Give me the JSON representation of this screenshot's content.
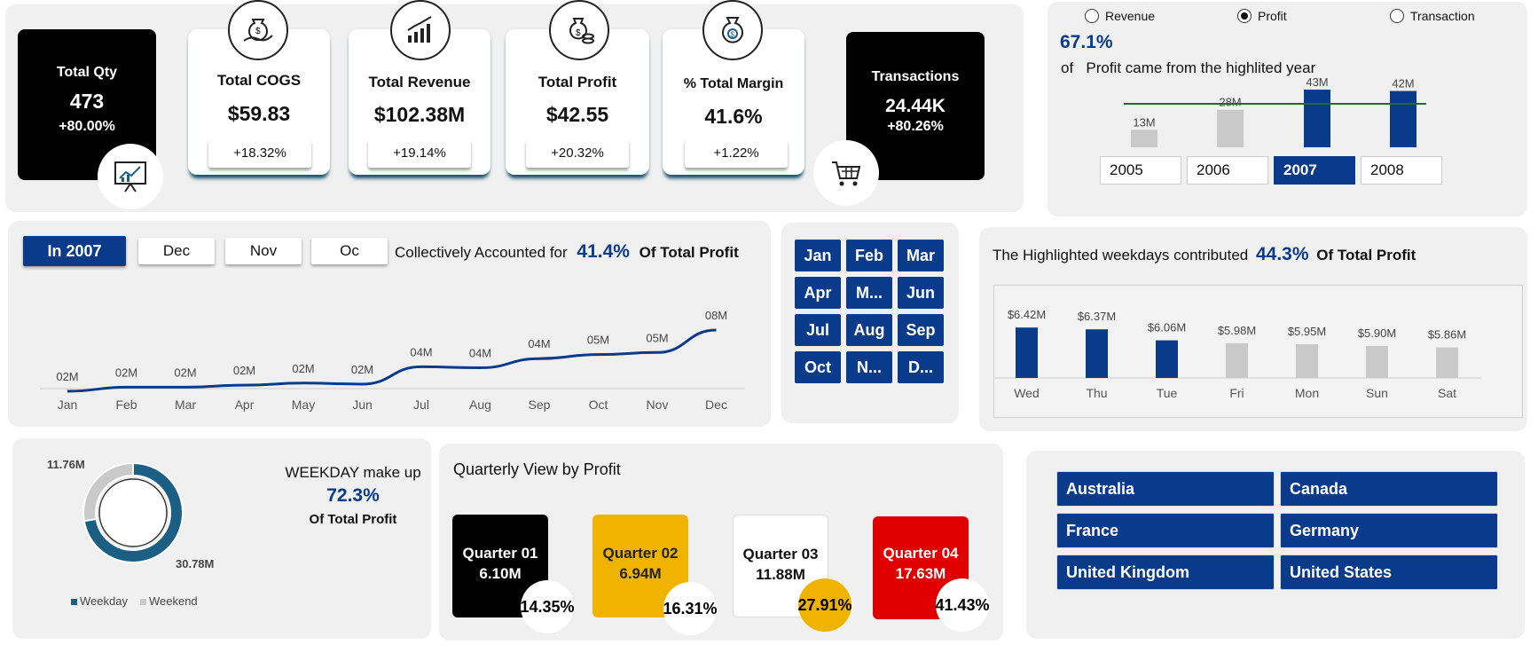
{
  "kpis": {
    "total_qty": {
      "title": "Total Qty",
      "value": "473",
      "change": "+80.00%"
    },
    "total_cogs": {
      "title": "Total COGS",
      "value": "$59.83",
      "change": "+18.32%"
    },
    "total_revenue": {
      "title": "Total Revenue",
      "value": "$102.38M",
      "change": "+19.14%"
    },
    "total_profit": {
      "title": "Total Profit",
      "value": "$42.55",
      "change": "+20.32%"
    },
    "total_margin": {
      "title": "% Total Margin",
      "value": "41.6%",
      "change": "+1.22%"
    },
    "transactions": {
      "title": "Transactions",
      "value": "24.44K",
      "change": "+80.26%"
    }
  },
  "year_panel": {
    "radios": [
      {
        "label": "Revenue",
        "selected": false
      },
      {
        "label": "Profit",
        "selected": true
      },
      {
        "label": "Transaction",
        "selected": false
      }
    ],
    "pct": "67.1%",
    "sentence_prefix": "of",
    "sentence": "Profit came from the highlited year",
    "years": [
      "2005",
      "2006",
      "2007",
      "2008"
    ],
    "selected_year": "2007"
  },
  "month_panel": {
    "tabs": [
      "In 2007",
      "Dec",
      "Nov",
      "Oc"
    ],
    "text_prefix": "Collectively Accounted for",
    "pct": "41.4%",
    "text_suffix": "Of Total Profit"
  },
  "month_slicer": [
    "Jan",
    "Feb",
    "Mar",
    "Apr",
    "M...",
    "Jun",
    "Jul",
    "Aug",
    "Sep",
    "Oct",
    "N...",
    "D..."
  ],
  "weekday_panel": {
    "text_prefix": "The Highlighted weekdays contributed",
    "pct": "44.3%",
    "text_suffix": "Of Total Profit"
  },
  "donut_panel": {
    "title": "WEEKDAY make up",
    "pct": "72.3%",
    "subtitle": "Of Total Profit",
    "weekend_label": "11.76M",
    "weekday_label": "30.78M",
    "legend": [
      "Weekday",
      "Weekend"
    ]
  },
  "quarter_panel": {
    "title": "Quarterly View by Profit",
    "quarters": [
      {
        "name": "Quarter 01",
        "value": "6.10M",
        "pct": "14.35%"
      },
      {
        "name": "Quarter 02",
        "value": "6.94M",
        "pct": "16.31%"
      },
      {
        "name": "Quarter 03",
        "value": "11.88M",
        "pct": "27.91%"
      },
      {
        "name": "Quarter 04",
        "value": "17.63M",
        "pct": "41.43%"
      }
    ]
  },
  "countries": [
    "Australia",
    "Canada",
    "France",
    "Germany",
    "United Kingdom",
    "United States"
  ],
  "colors": {
    "navy": "#0a3a8a",
    "teal": "#1b5f85",
    "grey": "#c9c9c9",
    "gold": "#f0b400",
    "red": "#e00000"
  },
  "chart_data": [
    {
      "type": "bar",
      "categories": [
        "2005",
        "2006",
        "2007",
        "2008"
      ],
      "values": [
        13,
        28,
        43,
        42
      ],
      "labels": [
        "13M",
        "28M",
        "43M",
        "42M"
      ],
      "highlighted": [
        "2007",
        "2008"
      ]
    },
    {
      "type": "line",
      "categories": [
        "Jan",
        "Feb",
        "Mar",
        "Apr",
        "May",
        "Jun",
        "Jul",
        "Aug",
        "Sep",
        "Oct",
        "Nov",
        "Dec"
      ],
      "values": [
        2,
        2.4,
        2.4,
        2.6,
        2.8,
        2.7,
        4.4,
        4.3,
        5.2,
        5.6,
        5.8,
        8.0
      ],
      "labels": [
        "02M",
        "02M",
        "02M",
        "02M",
        "02M",
        "02M",
        "04M",
        "04M",
        "04M",
        "05M",
        "05M",
        "08M"
      ]
    },
    {
      "type": "bar",
      "categories": [
        "Wed",
        "Thu",
        "Tue",
        "Fri",
        "Mon",
        "Sun",
        "Sat"
      ],
      "values": [
        6.42,
        6.37,
        6.06,
        5.98,
        5.95,
        5.9,
        5.86
      ],
      "labels": [
        "$6.42M",
        "$6.37M",
        "$6.06M",
        "$5.98M",
        "$5.95M",
        "$5.90M",
        "$5.86M"
      ],
      "highlighted": [
        "Wed",
        "Thu",
        "Tue"
      ]
    },
    {
      "type": "pie",
      "categories": [
        "Weekday",
        "Weekend"
      ],
      "values": [
        30.78,
        11.76
      ]
    }
  ]
}
